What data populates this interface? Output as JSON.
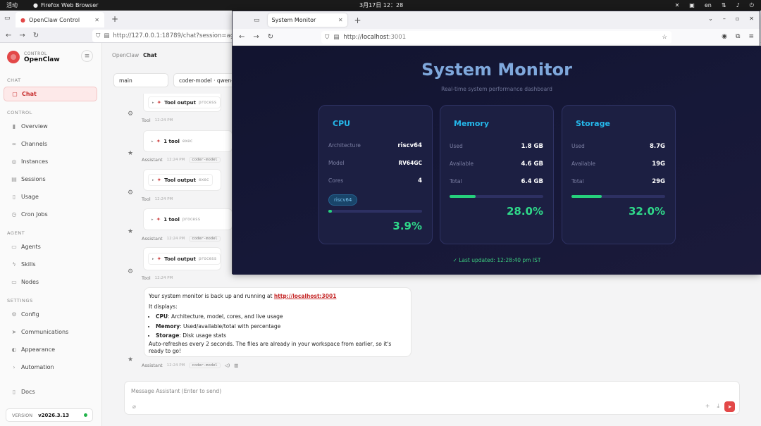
{
  "system_bar": {
    "activities": "活动",
    "app": "Firefox Web Browser",
    "clock": "3月17日  12：28",
    "lang": "en"
  },
  "back_browser": {
    "tab_title": "OpenClaw Control",
    "url": "http://127.0.0.1:18789/chat?session=agent"
  },
  "sidebar": {
    "brand_small": "CONTROL",
    "brand_name": "OpenClaw",
    "sections": {
      "chat": "CHAT",
      "control": "CONTROL",
      "agent": "AGENT",
      "settings": "SETTINGS"
    },
    "chat_items": [
      "Chat"
    ],
    "control_items": [
      "Overview",
      "Channels",
      "Instances",
      "Sessions",
      "Usage",
      "Cron Jobs"
    ],
    "agent_items": [
      "Agents",
      "Skills",
      "Nodes"
    ],
    "settings_items": [
      "Config",
      "Communications",
      "Appearance",
      "Automation"
    ],
    "docs": "Docs",
    "version_label": "VERSION",
    "version": "v2026.3.13"
  },
  "chat": {
    "breadcrumb_parent": "OpenClaw",
    "breadcrumb_current": "Chat",
    "session_select": "main",
    "model_select": "coder-model · qwen-",
    "tool_output": "Tool output",
    "one_tool": "1 tool",
    "process": "process",
    "exec": "exec",
    "tool_label": "Tool",
    "assistant_label": "Assistant",
    "time": "12:24 PM",
    "model_pill": "coder-model",
    "message": {
      "intro": "Your system monitor is back up and running at ",
      "link": "http://localhost:3001",
      "displays": "It displays:",
      "cpu_b": "CPU",
      "cpu_t": ": Architecture, model, cores, and live usage",
      "mem_b": "Memory",
      "mem_t": ": Used/available/total with percentage",
      "sto_b": "Storage",
      "sto_t": ": Disk usage stats",
      "outro": "Auto-refreshes every 2 seconds. The files are already in your workspace from earlier, so it's ready to go!"
    },
    "composer_placeholder": "Message Assistant (Enter to send)"
  },
  "front_browser": {
    "tab_title": "System Monitor",
    "url_scheme": "http://",
    "url_host": "localhost",
    "url_port": ":3001"
  },
  "monitor": {
    "title": "System Monitor",
    "subtitle": "Real-time system performance dashboard",
    "cpu": {
      "heading": "CPU",
      "arch_label": "Architecture",
      "arch": "riscv64",
      "model_label": "Model",
      "model": "RV64GC",
      "cores_label": "Cores",
      "cores": "4",
      "chip": "riscv64",
      "usage": 0.039,
      "pct": "3.9%"
    },
    "memory": {
      "heading": "Memory",
      "used_label": "Used",
      "used": "1.8 GB",
      "avail_label": "Available",
      "avail": "4.6 GB",
      "total_label": "Total",
      "total": "6.4 GB",
      "usage": 0.28,
      "pct": "28.0%"
    },
    "storage": {
      "heading": "Storage",
      "used_label": "Used",
      "used": "8.7G",
      "avail_label": "Available",
      "avail": "19G",
      "total_label": "Total",
      "total": "29G",
      "usage": 0.32,
      "pct": "32.0%"
    },
    "updated": "✓ Last updated: 12:28:40 pm IST"
  },
  "colors": {
    "accent": "#e34848",
    "monitor_heading": "#25b7ea",
    "monitor_good": "#2fd98a",
    "background_dark": "#12142f"
  }
}
